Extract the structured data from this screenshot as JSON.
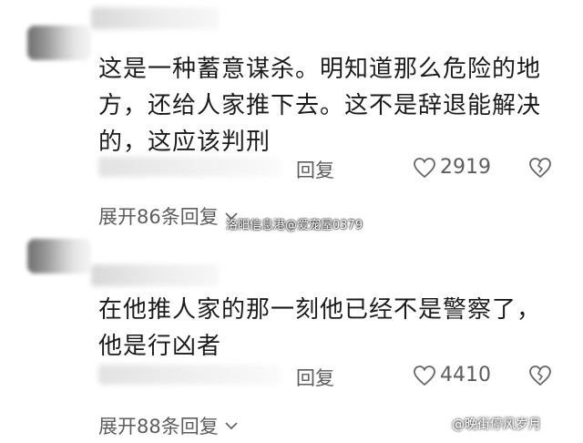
{
  "comments": [
    {
      "text_lines": [
        "这是一种蓄意谋杀。明知道那么危险的地",
        "方，还给人家推下去。这不是辞退能解决",
        "的，这应该判刑"
      ],
      "reply_label": "回复",
      "likes": "2919",
      "expand_label": "展开86条回复"
    },
    {
      "text_lines": [
        "在他推人家的那一刻他已经不是警察了，",
        "他是行凶者"
      ],
      "reply_label": "回复",
      "likes": "4410",
      "expand_label": "展开88条回复"
    }
  ],
  "watermark_text": "洛阳信息港@爱宠屋0379",
  "source_text": "@晚街停风岁月",
  "colors": {
    "text": "#1b1b1b",
    "muted": "#5d5d5d",
    "background": "#ffffff"
  },
  "icons": [
    "heart-outline-icon",
    "broken-heart-icon",
    "chevron-down-icon"
  ]
}
